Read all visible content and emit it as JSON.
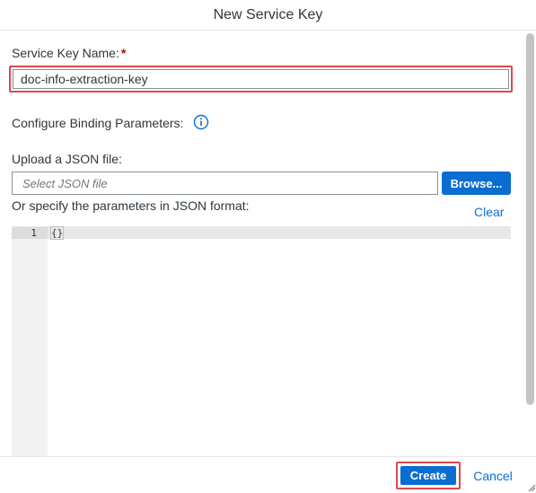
{
  "dialog": {
    "title": "New Service Key"
  },
  "form": {
    "service_key_name_label": "Service Key Name:",
    "required_marker": "*",
    "service_key_name_value": "doc-info-extraction-key",
    "binding_params_label": "Configure Binding Parameters:",
    "info_icon": "info-circle-icon",
    "upload_label": "Upload a JSON file:",
    "file_placeholder": "Select JSON file",
    "browse_label": "Browse...",
    "specify_label": "Or specify the parameters in JSON format:",
    "clear_label": "Clear"
  },
  "editor": {
    "line_numbers": [
      "1"
    ],
    "code": "{}"
  },
  "footer": {
    "create_label": "Create",
    "cancel_label": "Cancel"
  },
  "colors": {
    "accent": "#0a6ed1",
    "required": "#bb0000",
    "highlight": "#e0474c",
    "text": "#32363a"
  }
}
